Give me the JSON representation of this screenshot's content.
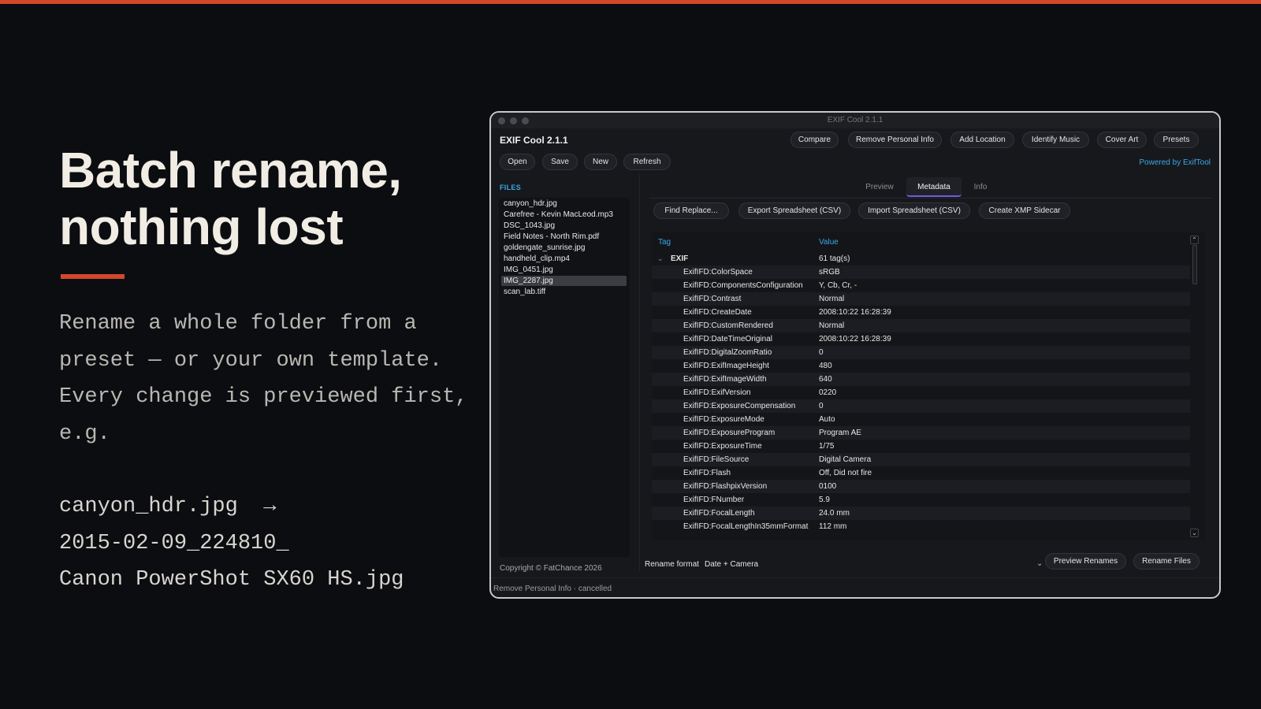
{
  "slide": {
    "headline": [
      "Batch rename,",
      "nothing lost"
    ],
    "description": "Rename a whole folder from a preset — or your own template. Every change is previewed first, e.g.",
    "example": [
      "canyon_hdr.jpg  →",
      "2015-02-09_224810_",
      "Canon PowerShot SX60 HS.jpg"
    ],
    "colors": {
      "accent": "#d2482b",
      "background": "#0c0d11",
      "link": "#3aa8e6"
    }
  },
  "window": {
    "title": "EXIF Cool 2.1.1",
    "app_name": "EXIF Cool  2.1.1",
    "top_buttons": [
      "Compare",
      "Remove Personal Info",
      "Add Location",
      "Identify Music",
      "Cover Art",
      "Presets"
    ],
    "file_buttons": [
      "Open",
      "Save",
      "New",
      "Refresh"
    ],
    "powered_by": "Powered by ExifTool",
    "files_label": "FILES",
    "files": [
      "canyon_hdr.jpg",
      "Carefree - Kevin MacLeod.mp3",
      "DSC_1043.jpg",
      "Field Notes - North Rim.pdf",
      "goldengate_sunrise.jpg",
      "handheld_clip.mp4",
      "IMG_0451.jpg",
      "IMG_2287.jpg",
      "scan_lab.tiff"
    ],
    "selected_file": "IMG_2287.jpg",
    "copyright": "Copyright © FatChance 2026",
    "tabs": [
      "Preview",
      "Metadata",
      "Info"
    ],
    "active_tab": "Metadata",
    "action_buttons": [
      "Find  Replace...",
      "Export Spreadsheet (CSV)",
      "Import Spreadsheet (CSV)",
      "Create XMP Sidecar"
    ],
    "table": {
      "headers": {
        "tag": "Tag",
        "value": "Value"
      },
      "group": {
        "tag": "EXIF",
        "value": "61 tag(s)"
      },
      "rows": [
        {
          "tag": "ExifIFD:ColorSpace",
          "value": "sRGB"
        },
        {
          "tag": "ExifIFD:ComponentsConfiguration",
          "value": "Y, Cb, Cr, -"
        },
        {
          "tag": "ExifIFD:Contrast",
          "value": "Normal"
        },
        {
          "tag": "ExifIFD:CreateDate",
          "value": "2008:10:22 16:28:39"
        },
        {
          "tag": "ExifIFD:CustomRendered",
          "value": "Normal"
        },
        {
          "tag": "ExifIFD:DateTimeOriginal",
          "value": "2008:10:22 16:28:39"
        },
        {
          "tag": "ExifIFD:DigitalZoomRatio",
          "value": "0"
        },
        {
          "tag": "ExifIFD:ExifImageHeight",
          "value": "480"
        },
        {
          "tag": "ExifIFD:ExifImageWidth",
          "value": "640"
        },
        {
          "tag": "ExifIFD:ExifVersion",
          "value": "0220"
        },
        {
          "tag": "ExifIFD:ExposureCompensation",
          "value": "0"
        },
        {
          "tag": "ExifIFD:ExposureMode",
          "value": "Auto"
        },
        {
          "tag": "ExifIFD:ExposureProgram",
          "value": "Program AE"
        },
        {
          "tag": "ExifIFD:ExposureTime",
          "value": "1/75"
        },
        {
          "tag": "ExifIFD:FileSource",
          "value": "Digital Camera"
        },
        {
          "tag": "ExifIFD:Flash",
          "value": "Off, Did not fire"
        },
        {
          "tag": "ExifIFD:FlashpixVersion",
          "value": "0100"
        },
        {
          "tag": "ExifIFD:FNumber",
          "value": "5.9"
        },
        {
          "tag": "ExifIFD:FocalLength",
          "value": "24.0 mm"
        },
        {
          "tag": "ExifIFD:FocalLengthIn35mmFormat",
          "value": "112 mm"
        }
      ]
    },
    "rename": {
      "label": "Rename format",
      "value": "Date + Camera",
      "preview_button": "Preview Renames",
      "rename_button": "Rename Files"
    },
    "status": "Remove Personal Info · cancelled"
  }
}
